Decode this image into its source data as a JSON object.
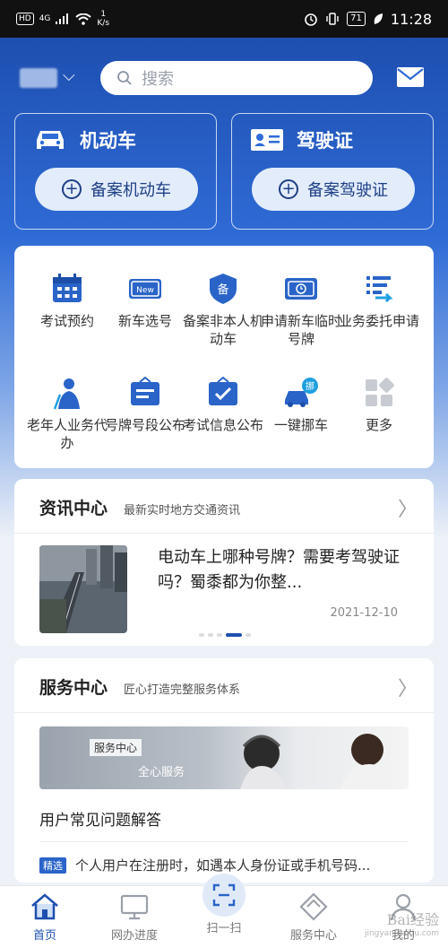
{
  "status_bar": {
    "hd": "HD",
    "network": "4G",
    "speed_value": "1",
    "speed_unit": "K/s",
    "battery": "71",
    "time": "11:28"
  },
  "header": {
    "search_placeholder": "搜索",
    "icons": [
      "search-icon",
      "mail-icon",
      "chevron-down-icon"
    ]
  },
  "quick_cards": [
    {
      "title": "机动车",
      "button": "备案机动车",
      "icon": "car-icon"
    },
    {
      "title": "驾驶证",
      "button": "备案驾驶证",
      "icon": "license-card-icon"
    }
  ],
  "services": [
    {
      "label": "考试预约",
      "icon": "calendar-icon"
    },
    {
      "label": "新车选号",
      "icon": "new-plate-icon"
    },
    {
      "label": "备案非本人机动车",
      "icon": "shield-bei-icon"
    },
    {
      "label": "申请新车临时号牌",
      "icon": "temp-plate-icon"
    },
    {
      "label": "业务委托申请",
      "icon": "delegate-icon"
    },
    {
      "label": "老年人业务代办",
      "icon": "elder-icon"
    },
    {
      "label": "号牌号段公布",
      "icon": "plate-board-icon"
    },
    {
      "label": "考试信息公布",
      "icon": "exam-board-icon"
    },
    {
      "label": "一键挪车",
      "icon": "move-car-icon"
    },
    {
      "label": "更多",
      "icon": "more-grid-icon"
    }
  ],
  "news": {
    "title": "资讯中心",
    "subtitle": "最新实时地方交通资讯",
    "article_title": "电动车上哪种号牌？需要考驾驶证吗？蜀黍都为你整...",
    "article_date": "2021-12-10"
  },
  "service_center": {
    "title": "服务中心",
    "subtitle": "匠心打造完整服务体系",
    "banner_badge": "服务中心",
    "banner_slogan": "全心服务",
    "faq_title": "用户常见问题解答",
    "faq_tag": "精选",
    "faq_text": "个人用户在注册时，如遇本人身份证或手机号码..."
  },
  "tabs": [
    {
      "label": "首页",
      "icon": "home-icon",
      "active": true
    },
    {
      "label": "网办进度",
      "icon": "monitor-icon",
      "active": false
    },
    {
      "label": "扫一扫",
      "icon": "scan-icon",
      "active": false
    },
    {
      "label": "服务中心",
      "icon": "service-diamond-icon",
      "active": false
    },
    {
      "label": "我的",
      "icon": "user-icon",
      "active": false
    }
  ],
  "watermark": {
    "main": "Bai经验",
    "sub": "jingyan.baidu.com"
  },
  "colors": {
    "primary": "#1e4fb0",
    "accent_light": "#e3ecfb",
    "icon_blue": "#2a64c8"
  }
}
